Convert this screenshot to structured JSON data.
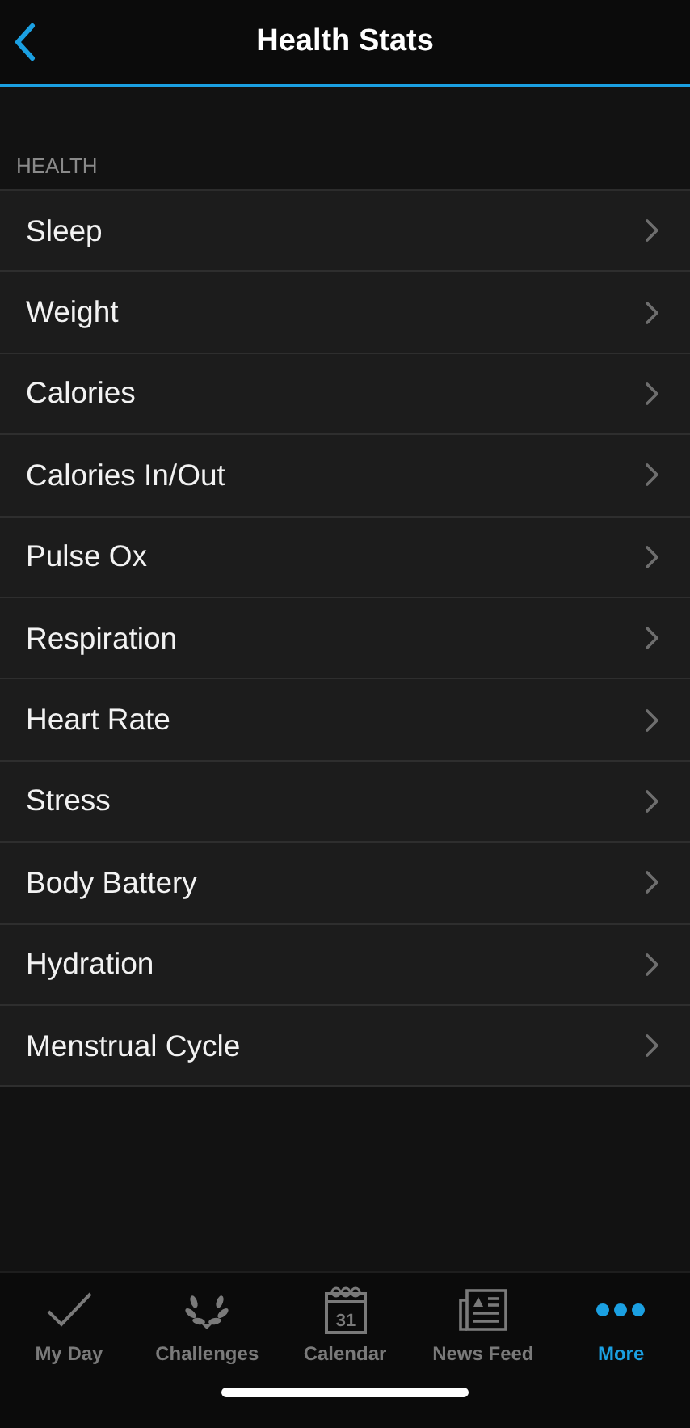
{
  "header": {
    "title": "Health Stats"
  },
  "section": {
    "label": "HEALTH"
  },
  "items": [
    {
      "label": "Sleep"
    },
    {
      "label": "Weight"
    },
    {
      "label": "Calories"
    },
    {
      "label": "Calories In/Out"
    },
    {
      "label": "Pulse Ox"
    },
    {
      "label": "Respiration"
    },
    {
      "label": "Heart Rate"
    },
    {
      "label": "Stress"
    },
    {
      "label": "Body Battery"
    },
    {
      "label": "Hydration"
    },
    {
      "label": "Menstrual Cycle"
    }
  ],
  "tab_bar": [
    {
      "label": "My Day",
      "kind": "check",
      "selected": false
    },
    {
      "label": "Challenges",
      "kind": "laurel",
      "selected": false
    },
    {
      "label": "Calendar",
      "kind": "calendar",
      "icon_text": "31",
      "selected": false
    },
    {
      "label": "News Feed",
      "kind": "news",
      "selected": false
    },
    {
      "label": "More",
      "kind": "more",
      "selected": true
    }
  ]
}
